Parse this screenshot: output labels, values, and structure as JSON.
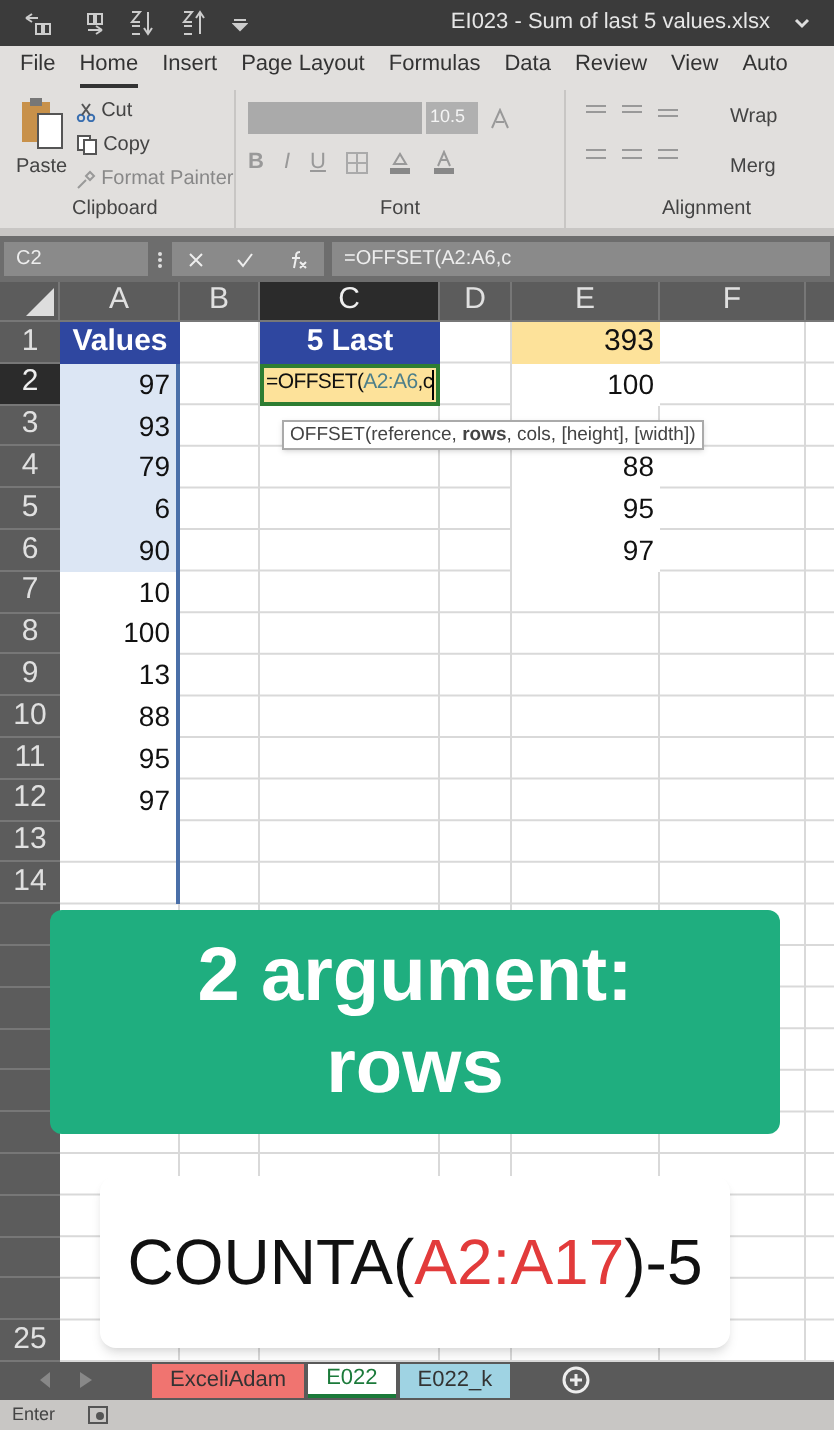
{
  "window": {
    "title": "EI023 - Sum of last 5 values.xlsx"
  },
  "ribbon_tabs": [
    {
      "label": "File",
      "selected": false
    },
    {
      "label": "Home",
      "selected": true
    },
    {
      "label": "Insert",
      "selected": false
    },
    {
      "label": "Page Layout",
      "selected": false
    },
    {
      "label": "Formulas",
      "selected": false
    },
    {
      "label": "Data",
      "selected": false
    },
    {
      "label": "Review",
      "selected": false
    },
    {
      "label": "View",
      "selected": false
    },
    {
      "label": "Auto",
      "selected": false
    }
  ],
  "clipboard": {
    "paste": "Paste",
    "cut": "Cut",
    "copy": "Copy",
    "format_painter": "Format Painter",
    "label": "Clipboard"
  },
  "font": {
    "size": "10.5",
    "bold": "B",
    "italic": "I",
    "underline": "U",
    "label": "Font"
  },
  "alignment": {
    "wrap": "Wrap",
    "merge": "Merg",
    "label": "Alignment"
  },
  "formula_bar": {
    "name_box": "C2",
    "formula": "=OFFSET(A2:A6,c"
  },
  "columns": [
    {
      "label": "A",
      "selected": false
    },
    {
      "label": "B",
      "selected": false
    },
    {
      "label": "C",
      "selected": true
    },
    {
      "label": "D",
      "selected": false
    },
    {
      "label": "E",
      "selected": false
    },
    {
      "label": "F",
      "selected": false
    }
  ],
  "rows": [
    {
      "label": "1",
      "selected": false,
      "cells": [
        {
          "text": "Values",
          "kind": "header"
        },
        null,
        {
          "text": "5 Last",
          "kind": "header"
        },
        null,
        {
          "text": "393",
          "kind": "result"
        }
      ]
    },
    {
      "label": "2",
      "selected": true,
      "cells": [
        {
          "text": "97",
          "kind": "value",
          "selected": true
        },
        null,
        {
          "kind": "editing",
          "selected": false,
          "parts": [
            {
              "text": "=OFFSET(",
              "kind": "plain"
            },
            {
              "text": "A2:A6",
              "kind": "reference"
            },
            {
              "text": ",c",
              "kind": "plain"
            }
          ]
        },
        null,
        {
          "text": "100",
          "kind": "value",
          "selected": false
        }
      ]
    },
    {
      "label": "3",
      "selected": false,
      "cells": [
        {
          "text": "93",
          "kind": "value",
          "selected": true
        }
      ]
    },
    {
      "label": "4",
      "selected": false,
      "cells": [
        {
          "text": "79",
          "kind": "value",
          "selected": true
        },
        null,
        null,
        null,
        {
          "text": "88",
          "kind": "value",
          "selected": false
        }
      ]
    },
    {
      "label": "5",
      "selected": false,
      "cells": [
        {
          "text": "6",
          "kind": "value",
          "selected": true
        },
        null,
        null,
        null,
        {
          "text": "95",
          "kind": "value",
          "selected": false
        }
      ]
    },
    {
      "label": "6",
      "selected": false,
      "cells": [
        {
          "text": "90",
          "kind": "value",
          "selected": true
        },
        null,
        null,
        null,
        {
          "text": "97",
          "kind": "value",
          "selected": false
        }
      ]
    },
    {
      "label": "7",
      "selected": false,
      "cells": [
        {
          "text": "10",
          "kind": "value",
          "selected": false
        }
      ]
    },
    {
      "label": "8",
      "selected": false,
      "cells": [
        {
          "text": "100",
          "kind": "value",
          "selected": false
        }
      ]
    },
    {
      "label": "9",
      "selected": false,
      "cells": [
        {
          "text": "13",
          "kind": "value",
          "selected": false
        }
      ]
    },
    {
      "label": "10",
      "selected": false,
      "cells": [
        {
          "text": "88",
          "kind": "value",
          "selected": false
        }
      ]
    },
    {
      "label": "11",
      "selected": false,
      "cells": [
        {
          "text": "95",
          "kind": "value",
          "selected": false
        }
      ]
    },
    {
      "label": "12",
      "selected": false,
      "cells": [
        {
          "text": "97",
          "kind": "value",
          "selected": false
        }
      ]
    },
    {
      "label": "13",
      "selected": false,
      "cells": []
    },
    {
      "label": "14",
      "selected": false,
      "cells": []
    },
    {
      "label": "25",
      "selected": false,
      "cells": []
    }
  ],
  "tooltip": "OFFSET(reference, **rows**, cols, [height], [width])",
  "banner": {
    "lines": [
      "2 argument:",
      "rows"
    ]
  },
  "formula_card": {
    "parts": [
      {
        "text": "COUNTA(",
        "kind": "plain"
      },
      {
        "text": "A2:A17",
        "kind": "reference"
      },
      {
        "text": ")-5",
        "kind": "plain"
      }
    ]
  },
  "sheet_tabs": [
    {
      "label": "ExceliAdam",
      "color": "#f07470",
      "selected": false
    },
    {
      "label": "E022",
      "color": "#ffffff",
      "selected": true
    },
    {
      "label": "E022_k",
      "color": "#9fd3e3",
      "selected": false
    }
  ],
  "status_bar": {
    "mode": "Enter"
  }
}
